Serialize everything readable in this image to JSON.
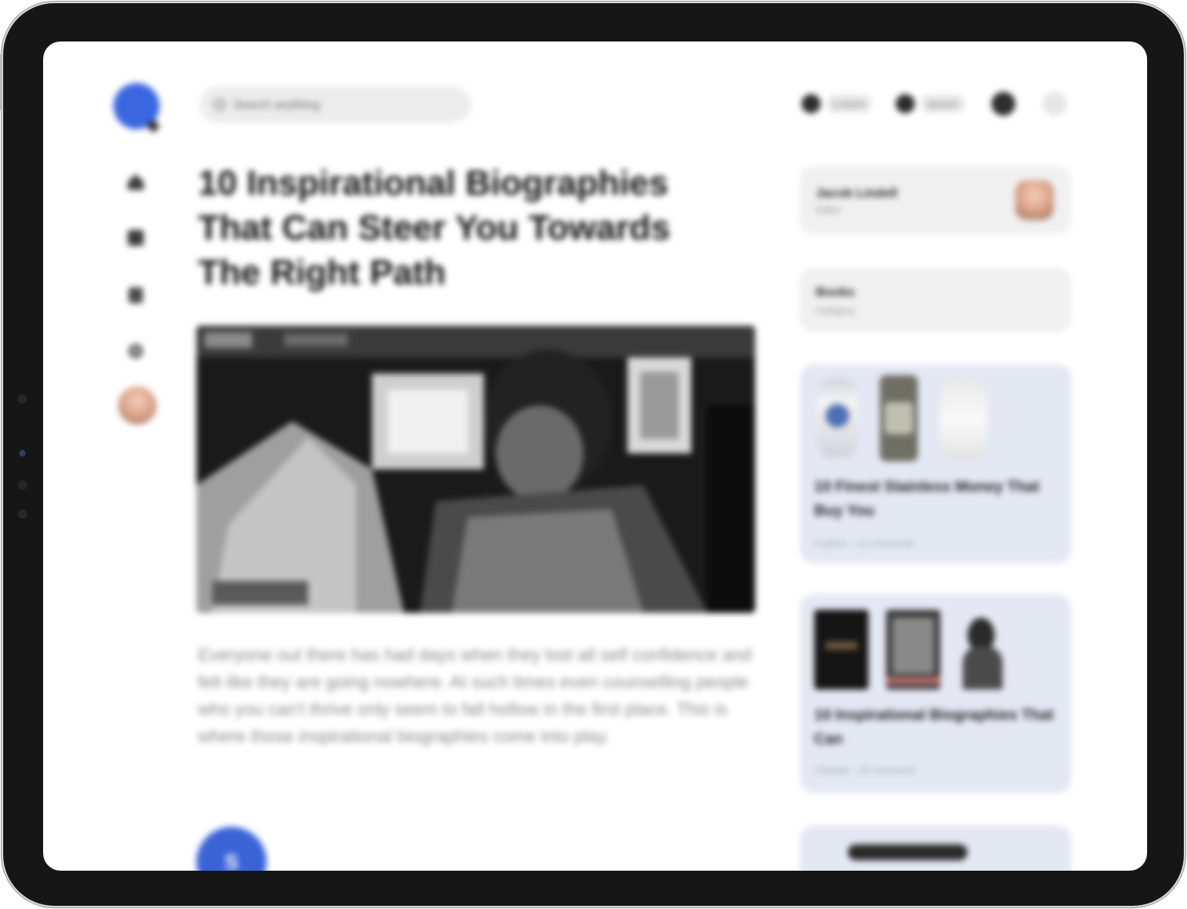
{
  "app": {
    "search_placeholder": "Search anything"
  },
  "header": {
    "chips": [
      {
        "label": "Lorem"
      },
      {
        "label": "Ipsum"
      }
    ]
  },
  "sidebar": {
    "items": [
      {
        "icon": "home-icon"
      },
      {
        "icon": "grid-icon"
      },
      {
        "icon": "bookmark-icon"
      },
      {
        "icon": "settings-icon"
      }
    ]
  },
  "article": {
    "title": "10 Inspirational Biographies That Can Steer You Towards The Right Path",
    "body": "Everyone out there has had days when they lost all self confidence and felt like they are going nowhere. At such times even counselling people who you can't thrive only seem to fall hollow in the first place. This is where those inspirational biographies come into play.",
    "author_initial": "S"
  },
  "right_panel": {
    "profile": {
      "name": "Jacob Lindell",
      "subtitle": "Editor"
    },
    "small_card": {
      "title": "Books",
      "subtitle": "Category"
    },
    "recommended": [
      {
        "title": "10 Finest Stainless Money That Buy You",
        "meta": "Fashion · 12 comments"
      },
      {
        "title": "10 Inspirational Biographies That Can",
        "meta": "Lifestyle · 24 comments"
      }
    ]
  },
  "colors": {
    "brand_blue": "#3a67e0",
    "device_frame": "#161616",
    "card_tint": "#e4e8f3",
    "card_grey": "#f0f0f0"
  }
}
